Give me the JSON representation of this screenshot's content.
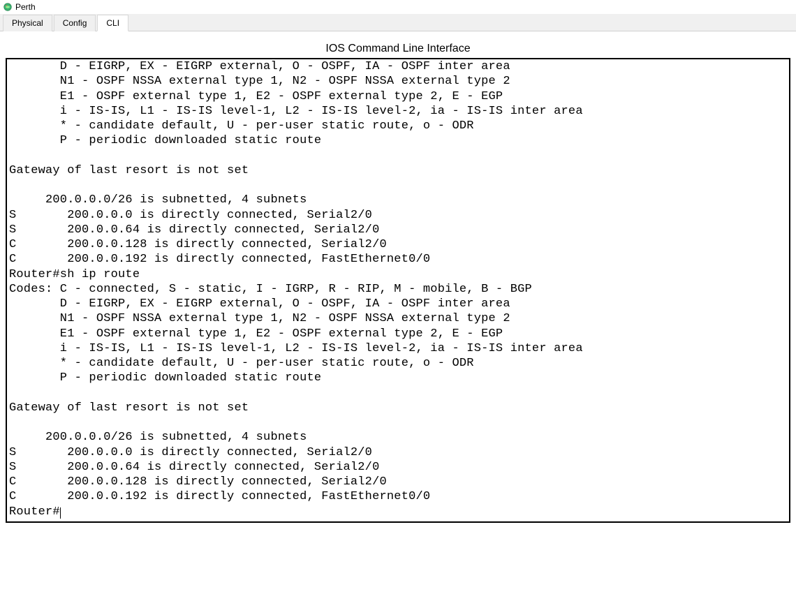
{
  "window": {
    "title": "Perth"
  },
  "tabs": [
    {
      "label": "Physical",
      "active": false
    },
    {
      "label": "Config",
      "active": false
    },
    {
      "label": "CLI",
      "active": true
    }
  ],
  "ios_header": "IOS Command Line Interface",
  "terminal_lines": [
    "       D - EIGRP, EX - EIGRP external, O - OSPF, IA - OSPF inter area",
    "       N1 - OSPF NSSA external type 1, N2 - OSPF NSSA external type 2",
    "       E1 - OSPF external type 1, E2 - OSPF external type 2, E - EGP",
    "       i - IS-IS, L1 - IS-IS level-1, L2 - IS-IS level-2, ia - IS-IS inter area",
    "       * - candidate default, U - per-user static route, o - ODR",
    "       P - periodic downloaded static route",
    "",
    "Gateway of last resort is not set",
    "",
    "     200.0.0.0/26 is subnetted, 4 subnets",
    "S       200.0.0.0 is directly connected, Serial2/0",
    "S       200.0.0.64 is directly connected, Serial2/0",
    "C       200.0.0.128 is directly connected, Serial2/0",
    "C       200.0.0.192 is directly connected, FastEthernet0/0",
    "Router#sh ip route",
    "Codes: C - connected, S - static, I - IGRP, R - RIP, M - mobile, B - BGP",
    "       D - EIGRP, EX - EIGRP external, O - OSPF, IA - OSPF inter area",
    "       N1 - OSPF NSSA external type 1, N2 - OSPF NSSA external type 2",
    "       E1 - OSPF external type 1, E2 - OSPF external type 2, E - EGP",
    "       i - IS-IS, L1 - IS-IS level-1, L2 - IS-IS level-2, ia - IS-IS inter area",
    "       * - candidate default, U - per-user static route, o - ODR",
    "       P - periodic downloaded static route",
    "",
    "Gateway of last resort is not set",
    "",
    "     200.0.0.0/26 is subnetted, 4 subnets",
    "S       200.0.0.0 is directly connected, Serial2/0",
    "S       200.0.0.64 is directly connected, Serial2/0",
    "C       200.0.0.128 is directly connected, Serial2/0",
    "C       200.0.0.192 is directly connected, FastEthernet0/0",
    "Router#"
  ]
}
